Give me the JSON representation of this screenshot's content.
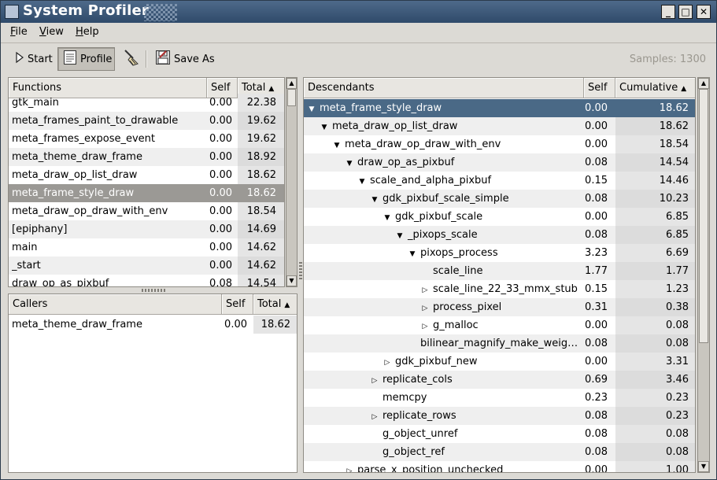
{
  "window": {
    "title": "System Profiler",
    "minimize": "_",
    "maximize": "□",
    "close": "✕"
  },
  "menu": [
    {
      "label": "File",
      "mnemonic": "F",
      "rest": "ile"
    },
    {
      "label": "View",
      "mnemonic": "V",
      "rest": "iew"
    },
    {
      "label": "Help",
      "mnemonic": "H",
      "rest": "elp"
    }
  ],
  "toolbar": {
    "start_label": "Start",
    "profile_label": "Profile",
    "save_as_label": "Save As",
    "samples": "Samples: 1300",
    "icons": {
      "start": "play-icon",
      "profile": "document-icon",
      "reset": "broom-icon",
      "save": "save-icon"
    }
  },
  "functions": {
    "columns": [
      "Functions",
      "Self",
      "Total"
    ],
    "sort_arrow": "▲",
    "rows": [
      {
        "name": "gtk_main",
        "self": "0.00",
        "total": "22.38"
      },
      {
        "name": "meta_frames_paint_to_drawable",
        "self": "0.00",
        "total": "19.62"
      },
      {
        "name": "meta_frames_expose_event",
        "self": "0.00",
        "total": "19.62"
      },
      {
        "name": "meta_theme_draw_frame",
        "self": "0.00",
        "total": "18.92"
      },
      {
        "name": "meta_draw_op_list_draw",
        "self": "0.00",
        "total": "18.62"
      },
      {
        "name": "meta_frame_style_draw",
        "self": "0.00",
        "total": "18.62"
      },
      {
        "name": "meta_draw_op_draw_with_env",
        "self": "0.00",
        "total": "18.54"
      },
      {
        "name": "[epiphany]",
        "self": "0.00",
        "total": "14.69"
      },
      {
        "name": "main",
        "self": "0.00",
        "total": "14.62"
      },
      {
        "name": "_start",
        "self": "0.00",
        "total": "14.62"
      },
      {
        "name": "draw_op_as_pixbuf",
        "self": "0.08",
        "total": "14.54"
      }
    ]
  },
  "callers": {
    "columns": [
      "Callers",
      "Self",
      "Total"
    ],
    "sort_arrow": "▲",
    "rows": [
      {
        "name": "meta_theme_draw_frame",
        "self": "0.00",
        "total": "18.62"
      }
    ]
  },
  "descendants": {
    "columns": [
      "Descendants",
      "Self",
      "Cumulative"
    ],
    "sort_arrow": "▲",
    "rows": [
      {
        "name": "meta_frame_style_draw",
        "self": "0.00",
        "cum": "18.62",
        "expander": "▼"
      },
      {
        "name": "meta_draw_op_list_draw",
        "self": "0.00",
        "cum": "18.62",
        "expander": "▼"
      },
      {
        "name": "meta_draw_op_draw_with_env",
        "self": "0.00",
        "cum": "18.54",
        "expander": "▼"
      },
      {
        "name": "draw_op_as_pixbuf",
        "self": "0.08",
        "cum": "14.54",
        "expander": "▼"
      },
      {
        "name": "scale_and_alpha_pixbuf",
        "self": "0.15",
        "cum": "14.46",
        "expander": "▼"
      },
      {
        "name": "gdk_pixbuf_scale_simple",
        "self": "0.08",
        "cum": "10.23",
        "expander": "▼"
      },
      {
        "name": "gdk_pixbuf_scale",
        "self": "0.00",
        "cum": "6.85",
        "expander": "▼"
      },
      {
        "name": "_pixops_scale",
        "self": "0.08",
        "cum": "6.85",
        "expander": "▼"
      },
      {
        "name": "pixops_process",
        "self": "3.23",
        "cum": "6.69",
        "expander": "▼"
      },
      {
        "name": "scale_line",
        "self": "1.77",
        "cum": "1.77",
        "expander": ""
      },
      {
        "name": "scale_line_22_33_mmx_stub",
        "self": "0.15",
        "cum": "1.23",
        "expander": "▷"
      },
      {
        "name": "process_pixel",
        "self": "0.31",
        "cum": "0.38",
        "expander": "▷"
      },
      {
        "name": "g_malloc",
        "self": "0.00",
        "cum": "0.08",
        "expander": "▷"
      },
      {
        "name": "bilinear_magnify_make_weig…",
        "self": "0.08",
        "cum": "0.08",
        "expander": ""
      },
      {
        "name": "gdk_pixbuf_new",
        "self": "0.00",
        "cum": "3.31",
        "expander": "▷"
      },
      {
        "name": "replicate_cols",
        "self": "0.69",
        "cum": "3.46",
        "expander": "▷"
      },
      {
        "name": "memcpy",
        "self": "0.23",
        "cum": "0.23",
        "expander": ""
      },
      {
        "name": "replicate_rows",
        "self": "0.08",
        "cum": "0.23",
        "expander": "▷"
      },
      {
        "name": "g_object_unref",
        "self": "0.08",
        "cum": "0.08",
        "expander": ""
      },
      {
        "name": "g_object_ref",
        "self": "0.08",
        "cum": "0.08",
        "expander": ""
      },
      {
        "name": "parse_x_position_unchecked",
        "self": "0.00",
        "cum": "1.00",
        "expander": "▷"
      }
    ]
  }
}
